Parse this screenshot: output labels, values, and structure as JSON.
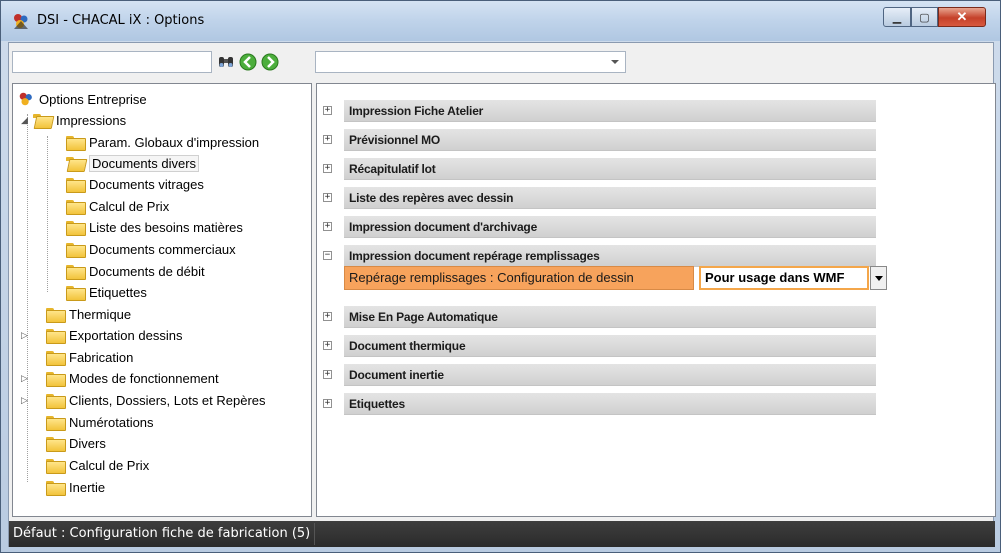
{
  "window": {
    "title": "DSI - CHACAL iX : Options"
  },
  "toolbar": {
    "search_value": "",
    "combo_value": "",
    "icons": [
      "binoculars-icon",
      "back-arrow-icon",
      "forward-arrow-icon"
    ]
  },
  "tree": {
    "root": "Options Entreprise",
    "items": [
      {
        "label": "Impressions",
        "level": 1,
        "expanded": true
      },
      {
        "label": "Param. Globaux d'impression",
        "level": 2
      },
      {
        "label": "Documents divers",
        "level": 2,
        "selected": true
      },
      {
        "label": "Documents vitrages",
        "level": 2
      },
      {
        "label": "Calcul de Prix",
        "level": 2
      },
      {
        "label": "Liste des besoins matières",
        "level": 2
      },
      {
        "label": "Documents commerciaux",
        "level": 2
      },
      {
        "label": "Documents de débit",
        "level": 2
      },
      {
        "label": "Etiquettes",
        "level": 2
      },
      {
        "label": "Thermique",
        "level": 1
      },
      {
        "label": "Exportation dessins",
        "level": 1,
        "collapsed": true
      },
      {
        "label": "Fabrication",
        "level": 1
      },
      {
        "label": "Modes de fonctionnement",
        "level": 1,
        "collapsed": true
      },
      {
        "label": "Clients, Dossiers, Lots et Repères",
        "level": 1,
        "collapsed": true
      },
      {
        "label": "Numérotations",
        "level": 1
      },
      {
        "label": "Divers",
        "level": 1
      },
      {
        "label": "Calcul de Prix",
        "level": 1
      },
      {
        "label": "Inertie",
        "level": 1
      }
    ]
  },
  "sections": [
    {
      "label": "Impression Fiche Atelier",
      "toggle": "+"
    },
    {
      "label": "Prévisionnel MO",
      "toggle": "+"
    },
    {
      "label": "Récapitulatif lot",
      "toggle": "+"
    },
    {
      "label": "Liste des repères avec dessin",
      "toggle": "+"
    },
    {
      "label": "Impression document d'archivage",
      "toggle": "+"
    },
    {
      "label": "Impression document repérage remplissages",
      "toggle": "−"
    },
    {
      "label": "Mise En Page Automatique",
      "toggle": "+"
    },
    {
      "label": "Document thermique",
      "toggle": "+"
    },
    {
      "label": "Document inertie",
      "toggle": "+"
    },
    {
      "label": "Etiquettes",
      "toggle": "+"
    }
  ],
  "option": {
    "label": "Repérage remplissages : Configuration de dessin",
    "value": "Pour usage dans WMF"
  },
  "status": {
    "text": "Défaut : Configuration fiche de fabrication (5)"
  },
  "colors": {
    "option_highlight": "#f7a35c",
    "statusbar": "#2b2b2b"
  }
}
